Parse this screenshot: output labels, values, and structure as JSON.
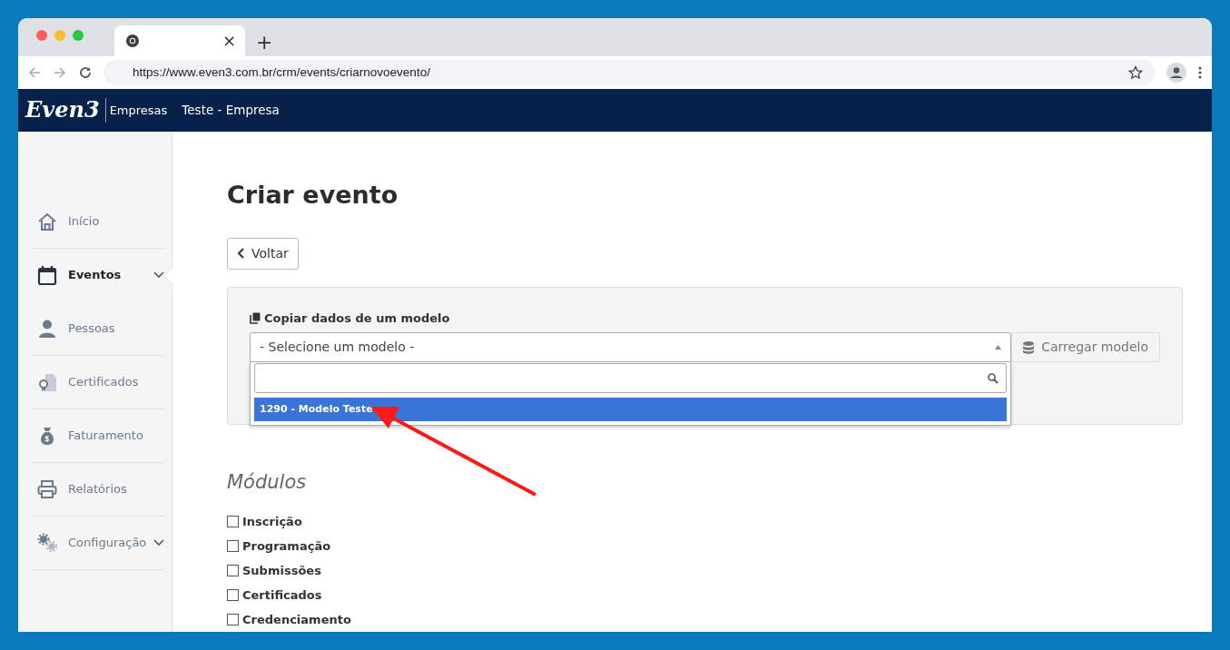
{
  "browser": {
    "tab_close": "×",
    "new_tab": "+",
    "url": "https://www.even3.com.br/crm/events/criarnovoevento/"
  },
  "header": {
    "logo": "Even3",
    "product": "Empresas",
    "company": "Teste - Empresa"
  },
  "sidebar": {
    "items": [
      {
        "label": "Início",
        "selected": false,
        "expandable": false
      },
      {
        "label": "Eventos",
        "selected": true,
        "expandable": true
      },
      {
        "label": "Pessoas",
        "selected": false,
        "expandable": false
      },
      {
        "label": "Certificados",
        "selected": false,
        "expandable": false
      },
      {
        "label": "Faturamento",
        "selected": false,
        "expandable": false
      },
      {
        "label": "Relatórios",
        "selected": false,
        "expandable": false
      },
      {
        "label": "Configuração",
        "selected": false,
        "expandable": true
      }
    ]
  },
  "page": {
    "title": "Criar evento",
    "back_button": "Voltar",
    "template_panel": {
      "label": "Copiar dados de um modelo",
      "select": {
        "value": "- Selecione um modelo -",
        "expanded": true,
        "options": [
          {
            "label": "1290 - Modelo Teste",
            "selected": true
          }
        ]
      },
      "load_button": "Carregar modelo"
    },
    "modules": {
      "title": "Módulos",
      "items": [
        {
          "label": "Inscrição",
          "checked": false
        },
        {
          "label": "Programação",
          "checked": false
        },
        {
          "label": "Submissões",
          "checked": false
        },
        {
          "label": "Certificados",
          "checked": false
        },
        {
          "label": "Credenciamento",
          "checked": false
        }
      ]
    }
  }
}
